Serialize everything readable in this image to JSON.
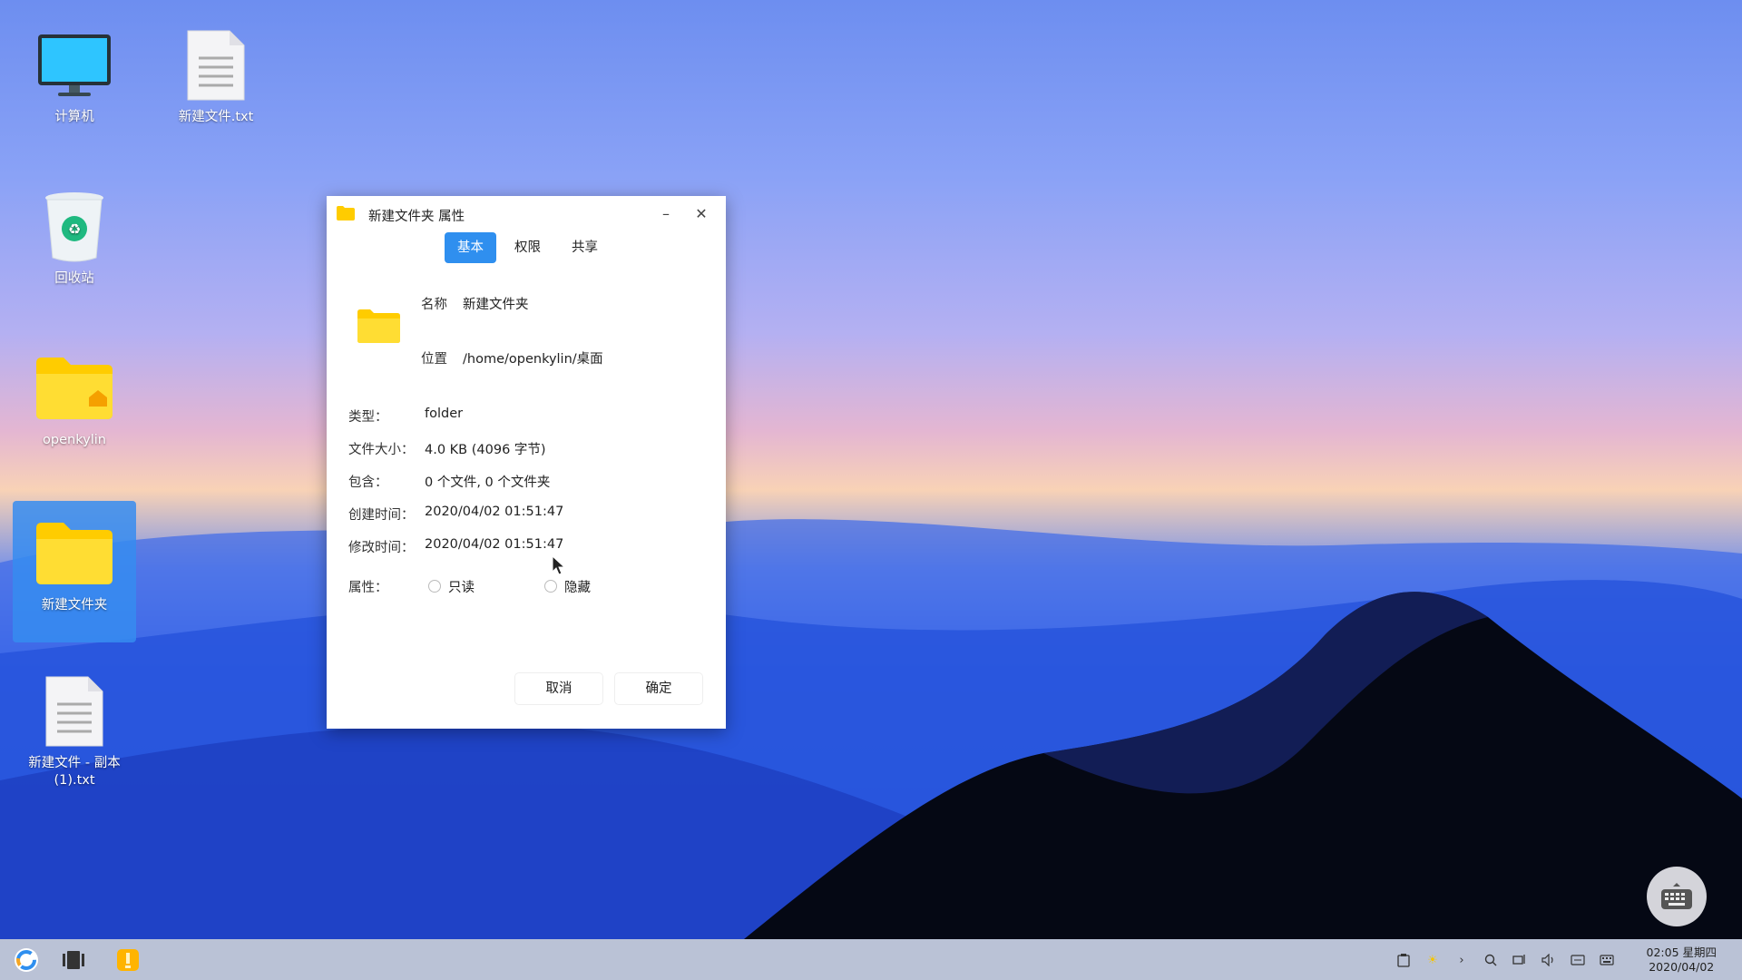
{
  "desktop": {
    "icons": [
      {
        "label": "计算机"
      },
      {
        "label": "新建文件.txt"
      },
      {
        "label": "回收站"
      },
      {
        "label": "openkylin"
      },
      {
        "label": "新建文件夹"
      },
      {
        "label": "新建文件 - 副本(1).txt"
      }
    ]
  },
  "dialog": {
    "title": "新建文件夹 属性",
    "tabs": [
      "基本",
      "权限",
      "共享"
    ],
    "active_tab": "基本",
    "name_label": "名称",
    "name_value": "新建文件夹",
    "location_label": "位置",
    "location_value": "/home/openkylin/桌面",
    "type_label": "类型：",
    "type_value": "folder",
    "size_label": "文件大小：",
    "size_value": "4.0 KB (4096 字节)",
    "contains_label": "包含：",
    "contains_value": "0 个文件, 0 个文件夹",
    "created_label": "创建时间：",
    "created_value": "2020/04/02 01:51:47",
    "modified_label": "修改时间：",
    "modified_value": "2020/04/02 01:51:47",
    "attributes_label": "属性：",
    "readonly_label": "只读",
    "hidden_label": "隐藏",
    "cancel_label": "取消",
    "ok_label": "确定"
  },
  "taskbar": {
    "time": "02:05 星期四",
    "date": "2020/04/02"
  },
  "colors": {
    "accent": "#2f8fef",
    "folder": "#ffd11a"
  }
}
